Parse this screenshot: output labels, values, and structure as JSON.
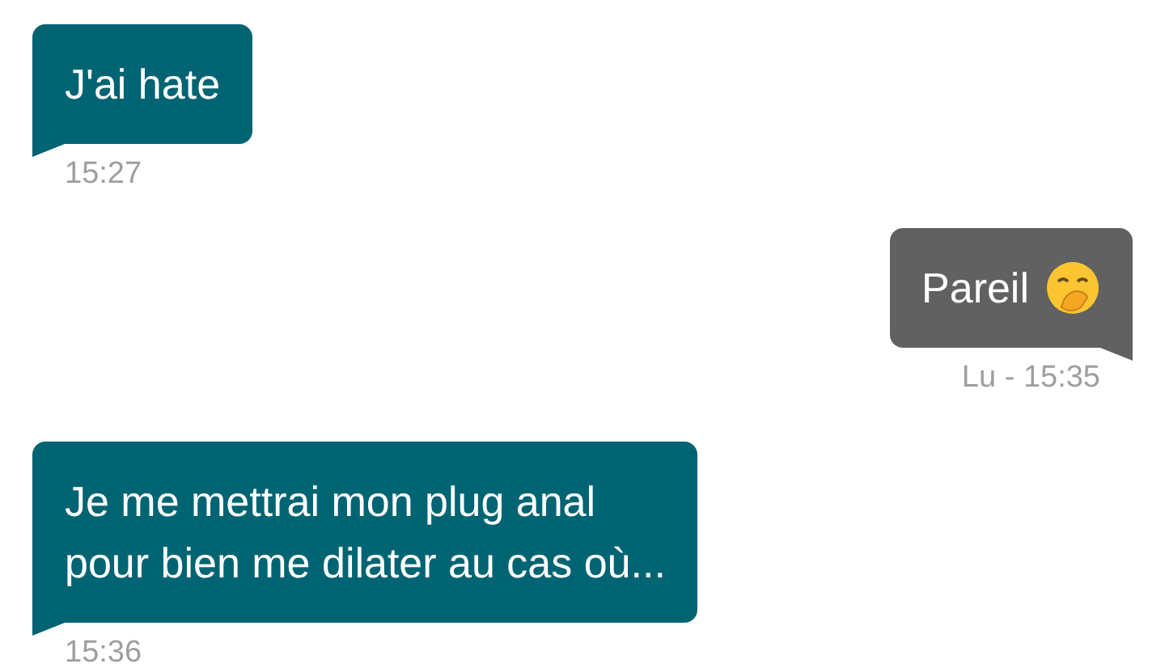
{
  "messages": [
    {
      "kind": "received",
      "lines": [
        "J'ai hate"
      ],
      "emoji": false,
      "time": "15:27"
    },
    {
      "kind": "sent",
      "lines": [
        "Pareil"
      ],
      "emoji": true,
      "time": "Lu - 15:35"
    },
    {
      "kind": "received",
      "lines": [
        "Je me mettrai mon plug anal",
        "pour bien me dilater au cas où..."
      ],
      "emoji": false,
      "time": "15:36"
    }
  ]
}
